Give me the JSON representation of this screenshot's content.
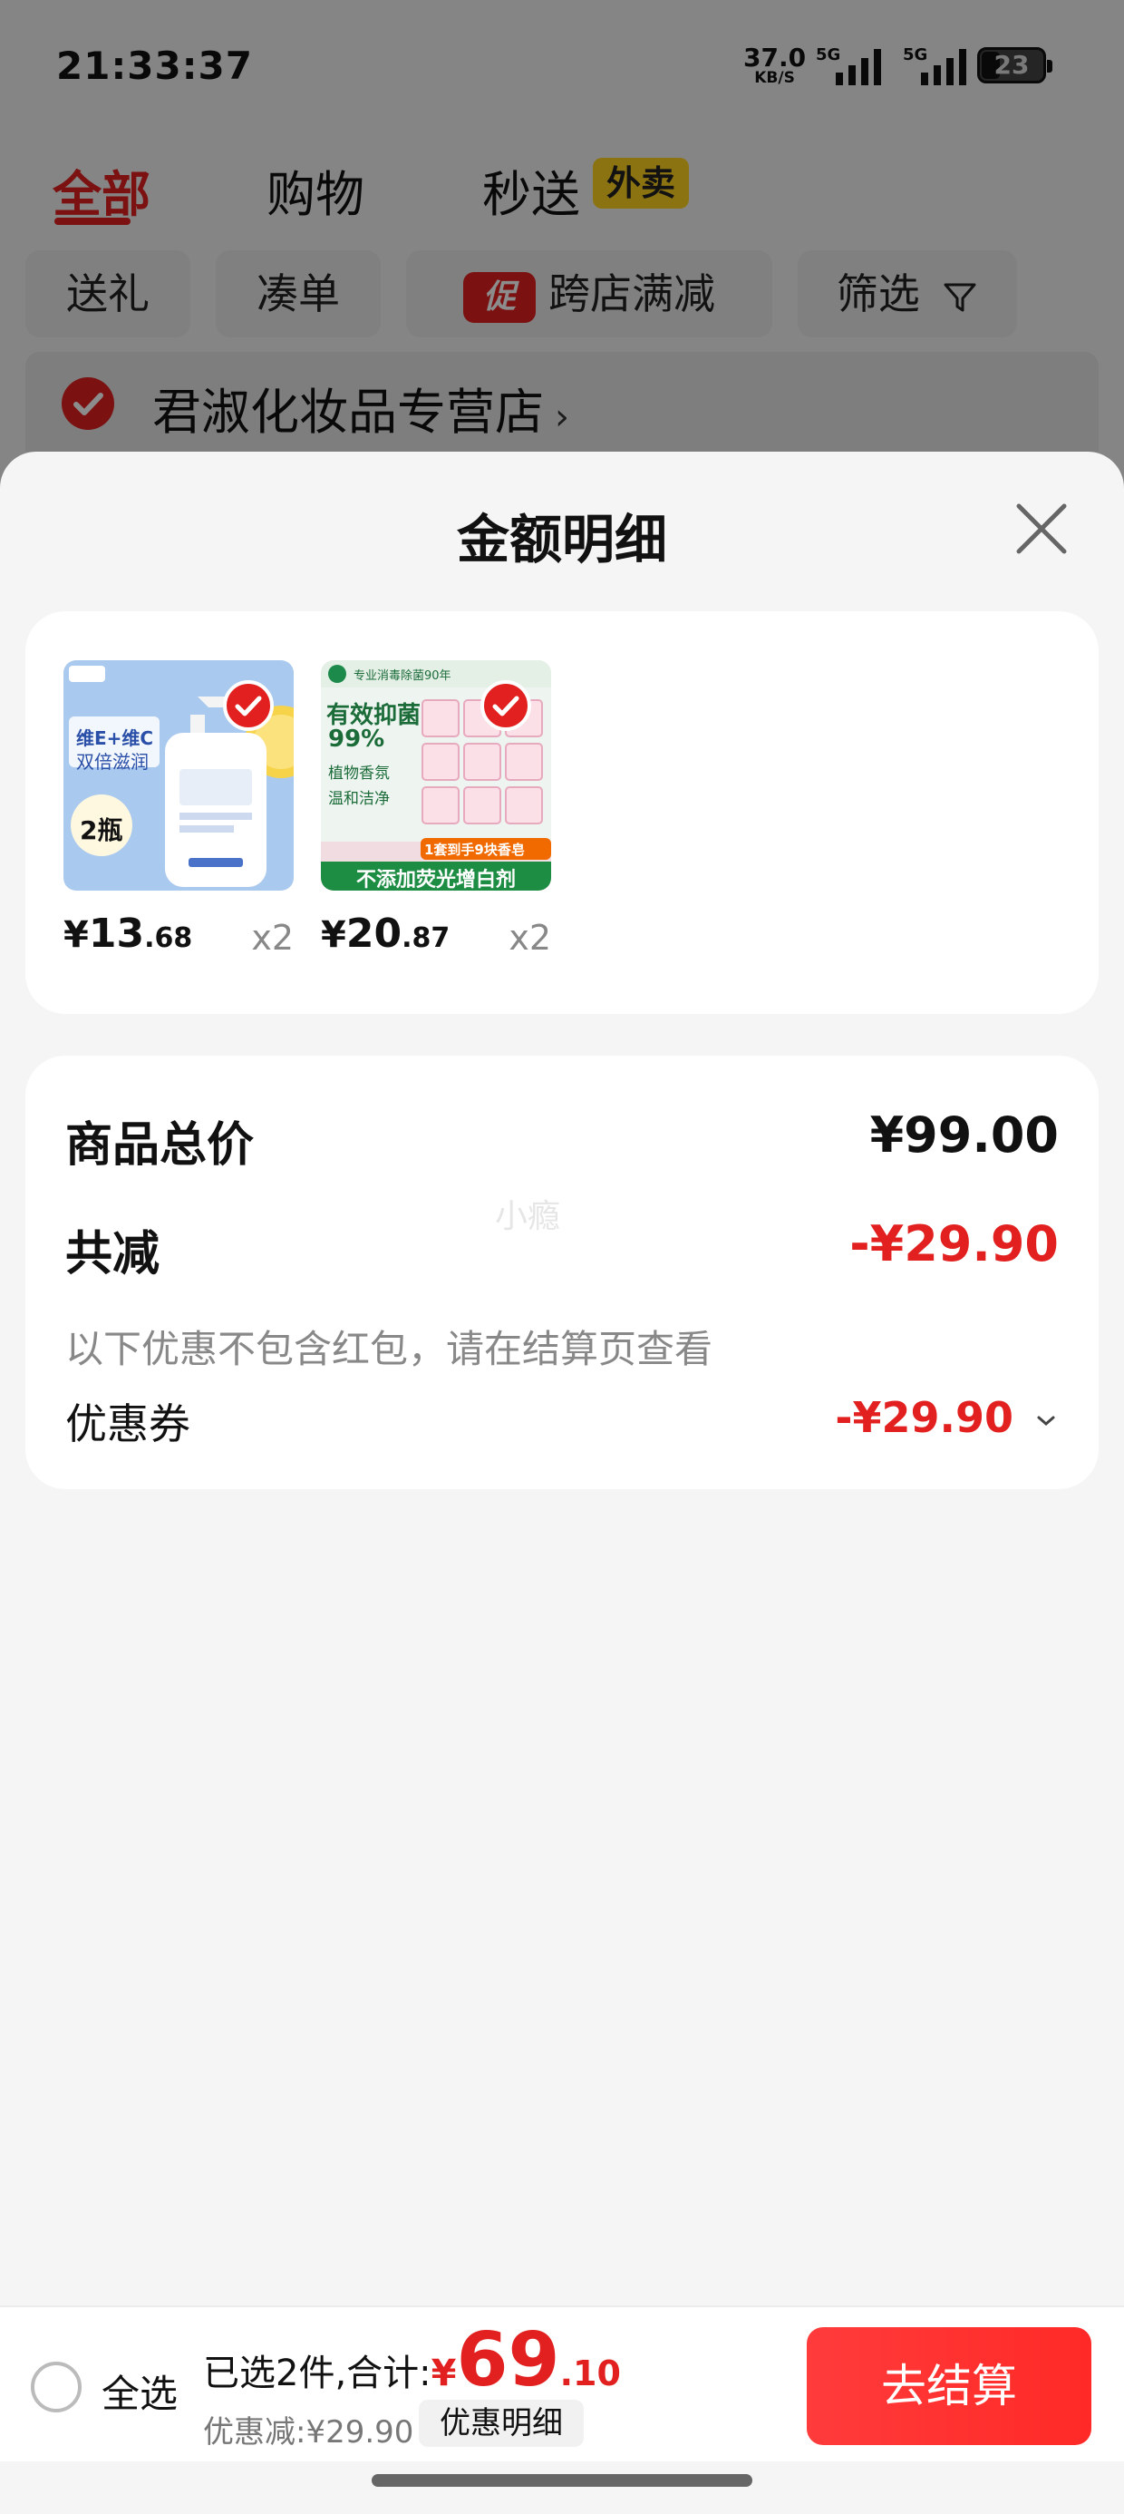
{
  "status_bar": {
    "time": "21:33:37",
    "speed_value": "37.0",
    "speed_unit": "KB/S",
    "network1": "5G",
    "network2": "5G",
    "battery": "23"
  },
  "top_tabs": [
    {
      "label": "全部",
      "active": true
    },
    {
      "label": "购物",
      "active": false
    },
    {
      "label": "秒送",
      "active": false
    }
  ],
  "waimai_tag": "外卖",
  "filter_chips": {
    "gift": "送礼",
    "combine": "凑单",
    "promo_badge": "促",
    "cross_store": "跨店满减",
    "filter": "筛选"
  },
  "store": {
    "name": "君淑化妆品专营店",
    "arrow": "›"
  },
  "sheet": {
    "title": "金额明细",
    "products": [
      {
        "image_texts": {
          "quote": "维E+维C",
          "line2": "双倍滋润",
          "badge": "2瓶"
        },
        "price_symbol": "¥",
        "price_int": "13",
        "price_dec": ".68",
        "qty": "x2"
      },
      {
        "image_texts": {
          "top": "专业消毒除菌90年",
          "big": "有效抑菌",
          "pct": "99%",
          "c1": "植物香氛",
          "c2": "温和洁净",
          "tag": "1套到手9块香皂",
          "banner": "不添加荧光增白剂"
        },
        "price_symbol": "¥",
        "price_int": "20",
        "price_dec": ".87",
        "qty": "x2"
      }
    ],
    "summary": {
      "total_label": "商品总价",
      "total_value": "¥99.00",
      "discount_label": "共减",
      "discount_value": "-¥29.90",
      "note": "以下优惠不包含红包，请在结算页查看",
      "coupon_label": "优惠券",
      "coupon_value": "-¥29.90"
    },
    "watermark": "小瘾"
  },
  "bottom_bar": {
    "select_all": "全选",
    "selected_label": "已选2件,合计:",
    "total_symbol": "¥",
    "total_int": "69",
    "total_dec": ".10",
    "discount_line": "优惠减:¥29.90",
    "detail_button": "优惠明细",
    "checkout_button": "去结算"
  },
  "colors": {
    "accent_red": "#e1201f",
    "waimai_yellow": "#ffd21f"
  }
}
